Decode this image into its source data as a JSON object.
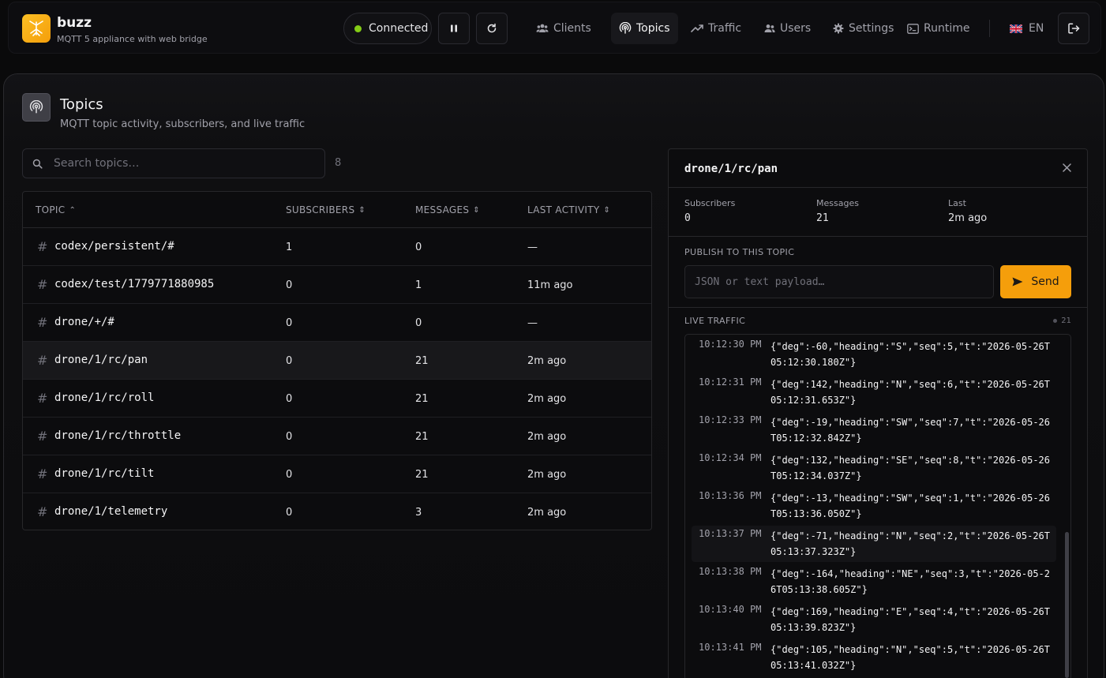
{
  "app": {
    "name": "buzz",
    "tagline": "MQTT 5 appliance with web bridge"
  },
  "status": {
    "label": "Connected",
    "color": "#84cc16"
  },
  "nav": [
    {
      "label": "Clients",
      "icon": "users-icon"
    },
    {
      "label": "Topics",
      "icon": "broadcast-icon",
      "active": true
    },
    {
      "label": "Traffic",
      "icon": "trending-icon"
    },
    {
      "label": "Users",
      "icon": "user-icon"
    },
    {
      "label": "Settings",
      "icon": "gear-icon"
    },
    {
      "label": "Runtime",
      "icon": "terminal-icon"
    }
  ],
  "lang": {
    "label": "EN",
    "flag": "uk-flag"
  },
  "page": {
    "title": "Topics",
    "subtitle": "MQTT topic activity, subscribers, and live traffic"
  },
  "search": {
    "placeholder": "Search topics…",
    "count": "8"
  },
  "table": {
    "headers": {
      "topic": "TOPIC",
      "subscribers": "SUBSCRIBERS",
      "messages": "MESSAGES",
      "last": "LAST ACTIVITY"
    },
    "rows": [
      {
        "topic": "codex/persistent/#",
        "subscribers": "1",
        "messages": "0",
        "last": "—"
      },
      {
        "topic": "codex/test/1779771880985",
        "subscribers": "0",
        "messages": "1",
        "last": "11m ago"
      },
      {
        "topic": "drone/+/#",
        "subscribers": "0",
        "messages": "0",
        "last": "—"
      },
      {
        "topic": "drone/1/rc/pan",
        "subscribers": "0",
        "messages": "21",
        "last": "2m ago"
      },
      {
        "topic": "drone/1/rc/roll",
        "subscribers": "0",
        "messages": "21",
        "last": "2m ago"
      },
      {
        "topic": "drone/1/rc/throttle",
        "subscribers": "0",
        "messages": "21",
        "last": "2m ago"
      },
      {
        "topic": "drone/1/rc/tilt",
        "subscribers": "0",
        "messages": "21",
        "last": "2m ago"
      },
      {
        "topic": "drone/1/telemetry",
        "subscribers": "0",
        "messages": "3",
        "last": "2m ago"
      }
    ]
  },
  "detail": {
    "topic": "drone/1/rc/pan",
    "stats": [
      {
        "label": "Subscribers",
        "value": "0"
      },
      {
        "label": "Messages",
        "value": "21"
      },
      {
        "label": "Last",
        "value": "2m ago"
      }
    ],
    "publish_label": "PUBLISH TO THIS TOPIC",
    "publish_placeholder": "JSON or text payload…",
    "send_label": "Send",
    "live_label": "LIVE TRAFFIC",
    "live_count": "21",
    "messages": [
      {
        "time": "10:12:30 PM",
        "payload": "{\"deg\":-60,\"heading\":\"S\",\"seq\":5,\"t\":\"2026-05-26T05:12:30.180Z\"}"
      },
      {
        "time": "10:12:31 PM",
        "payload": "{\"deg\":142,\"heading\":\"N\",\"seq\":6,\"t\":\"2026-05-26T05:12:31.653Z\"}"
      },
      {
        "time": "10:12:33 PM",
        "payload": "{\"deg\":-19,\"heading\":\"SW\",\"seq\":7,\"t\":\"2026-05-26T05:12:32.842Z\"}"
      },
      {
        "time": "10:12:34 PM",
        "payload": "{\"deg\":132,\"heading\":\"SE\",\"seq\":8,\"t\":\"2026-05-26T05:12:34.037Z\"}"
      },
      {
        "time": "10:13:36 PM",
        "payload": "{\"deg\":-13,\"heading\":\"SW\",\"seq\":1,\"t\":\"2026-05-26T05:13:36.050Z\"}"
      },
      {
        "time": "10:13:37 PM",
        "payload": "{\"deg\":-71,\"heading\":\"N\",\"seq\":2,\"t\":\"2026-05-26T05:13:37.323Z\"}",
        "highlight": true
      },
      {
        "time": "10:13:38 PM",
        "payload": "{\"deg\":-164,\"heading\":\"NE\",\"seq\":3,\"t\":\"2026-05-26T05:13:38.605Z\"}"
      },
      {
        "time": "10:13:40 PM",
        "payload": "{\"deg\":169,\"heading\":\"E\",\"seq\":4,\"t\":\"2026-05-26T05:13:39.823Z\"}"
      },
      {
        "time": "10:13:41 PM",
        "payload": "{\"deg\":105,\"heading\":\"N\",\"seq\":5,\"t\":\"2026-05-26T05:13:41.032Z\"}"
      }
    ]
  },
  "colors": {
    "accent": "#f59e0b",
    "connected": "#84cc16"
  }
}
